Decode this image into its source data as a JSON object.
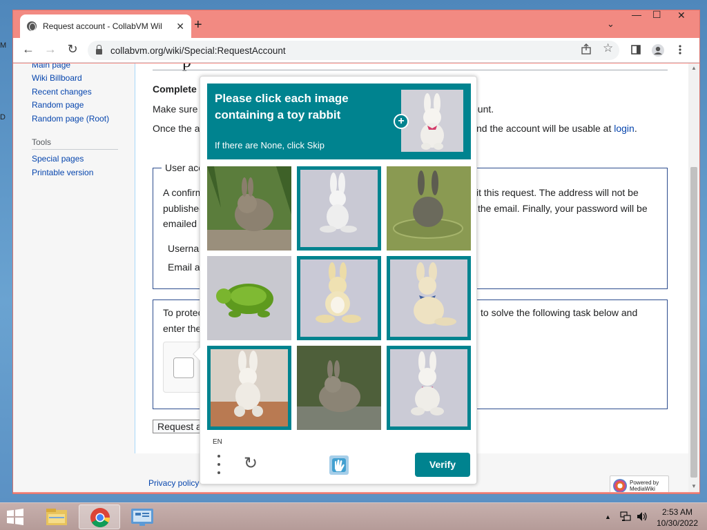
{
  "desktop": {
    "left_edge_letters": [
      "M",
      "D"
    ]
  },
  "browser": {
    "tab_title": "Request account - CollabVM Wiki",
    "tab_close": "✕",
    "new_tab": "+",
    "tab_search": "⌄",
    "window_controls": {
      "minimize": "—",
      "maximize": "☐",
      "close": "✕"
    },
    "nav": {
      "back": "←",
      "forward": "→",
      "reload": "↻"
    },
    "url": "collabvm.org/wiki/Special:RequestAccount",
    "toolbar_icons": [
      "share-icon",
      "star-icon",
      "side-panel-icon",
      "profile-icon",
      "kebab-menu-icon"
    ]
  },
  "sidebar": {
    "nav_links": [
      "Main page",
      "Wiki Billboard",
      "Recent changes",
      "Random page",
      "Random page (Root)"
    ],
    "tools_heading": "Tools",
    "tools_links": [
      "Special pages",
      "Printable version"
    ]
  },
  "content": {
    "heading_fragment": "p",
    "complete_label": "Complete a",
    "line1_left": "Make sure t",
    "line1_right": "ount.",
    "line2_left": "Once the ac",
    "line2_right_pre": "nd the account will be usable at ",
    "line2_link": "login",
    "line2_end": ".",
    "user_fieldset_legend": "User acc",
    "confirm_left": [
      "A confirm",
      "publishec",
      "emailed t"
    ],
    "confirm_right": [
      "it this request. The address will not be",
      " the email. Finally, your password will be"
    ],
    "username_label": "Usernar",
    "email_label": "Email ad",
    "protect_left": [
      "To protec",
      "enter the"
    ],
    "protect_right": "to solve the following task below and",
    "submit_button": "Request ac",
    "footer_link": "Privacy policy",
    "powered_by": "Powered by",
    "mediawiki": "MediaWiki"
  },
  "captcha": {
    "prompt": "Please click each image containing a toy rabbit",
    "skip_hint": "If there are None, click Skip",
    "plus": "+",
    "tiles": [
      {
        "subject": "real-rabbit-in-grass",
        "selected": false
      },
      {
        "subject": "toy-rabbit-white",
        "selected": true
      },
      {
        "subject": "real-rabbit-in-water",
        "selected": false
      },
      {
        "subject": "toy-turtle",
        "selected": false
      },
      {
        "subject": "toy-rabbit-cream",
        "selected": true
      },
      {
        "subject": "toy-rabbit-blue-bow",
        "selected": true
      },
      {
        "subject": "toy-rabbit-sitting",
        "selected": true
      },
      {
        "subject": "real-rabbit-wild",
        "selected": false
      },
      {
        "subject": "toy-rabbit-pink-bow",
        "selected": true
      }
    ],
    "language": "EN",
    "refresh": "↻",
    "verify_button": "Verify",
    "accent_color": "#00838f"
  },
  "taskbar": {
    "apps": [
      "file-explorer-icon",
      "chrome-icon",
      "control-panel-icon"
    ],
    "active_app": "chrome-icon",
    "tray": {
      "flag": "▲",
      "network": "🖧",
      "volume": "🔊"
    },
    "time": "2:53 AM",
    "date": "10/30/2022"
  }
}
